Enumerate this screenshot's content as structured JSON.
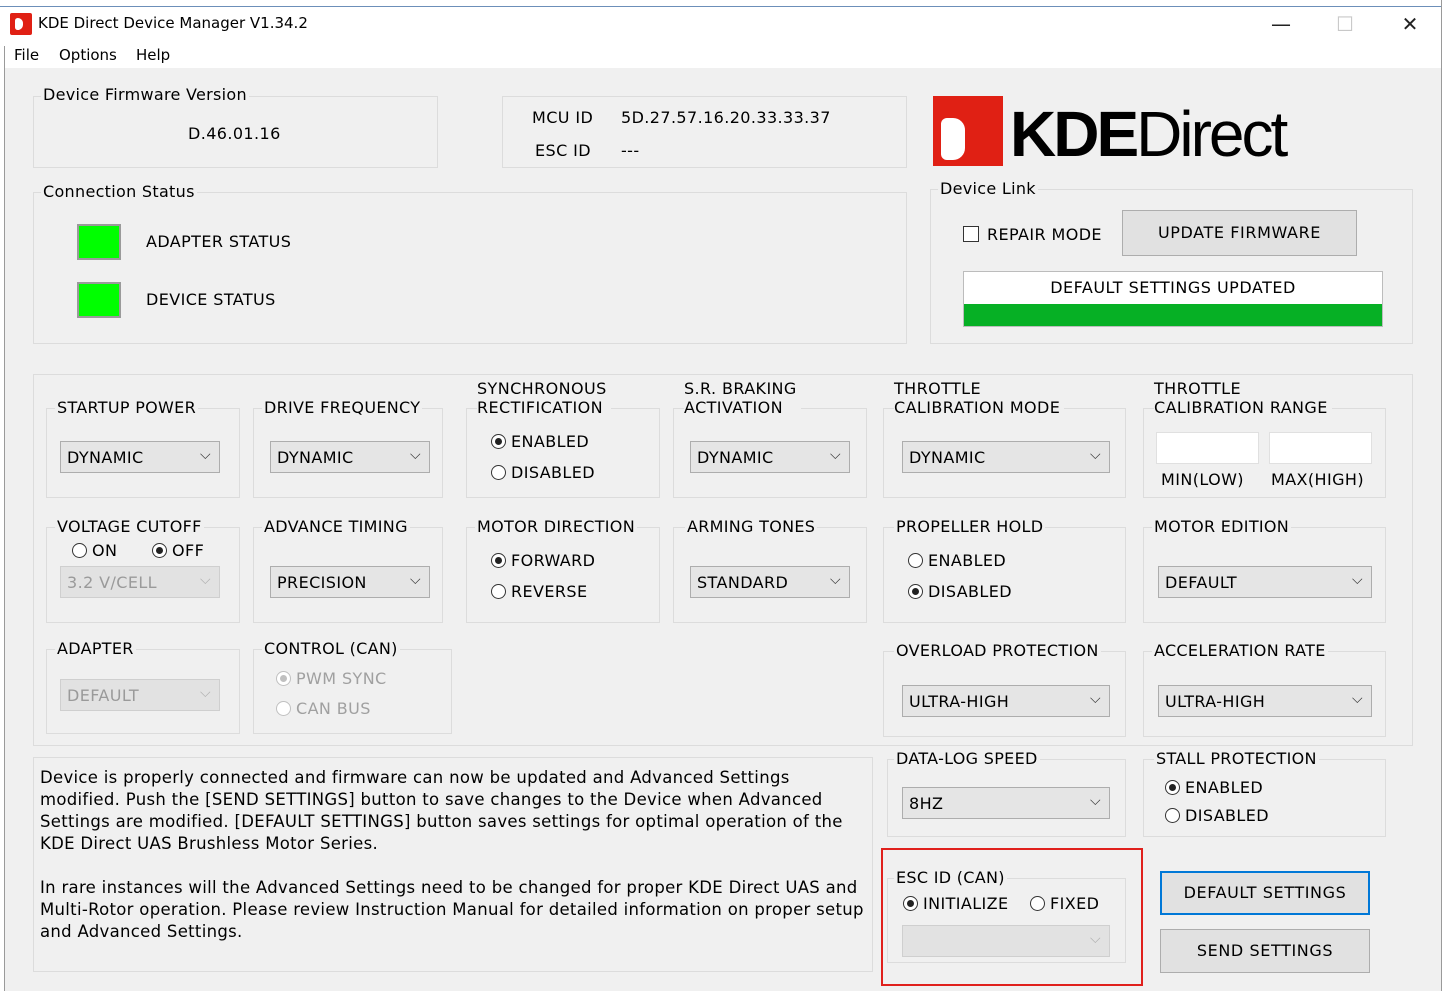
{
  "window": {
    "title": "KDE Direct Device Manager V1.34.2",
    "controls": {
      "minimize": "—",
      "maximize": "☐",
      "close": "✕"
    }
  },
  "menu": [
    "File",
    "Options",
    "Help"
  ],
  "logo": {
    "text_bold": "KDE",
    "text_light": "Direct",
    "color": "#e02014"
  },
  "firmware": {
    "label": "Device Firmware Version",
    "value": "D.46.01.16"
  },
  "ids": {
    "mcu_label": "MCU ID",
    "mcu_value": "5D.27.57.16.20.33.33.37",
    "esc_label": "ESC ID",
    "esc_value": "---"
  },
  "connection": {
    "label": "Connection Status",
    "adapter": "ADAPTER STATUS",
    "device": "DEVICE STATUS",
    "led_color": "#00ff00"
  },
  "device_link": {
    "label": "Device Link",
    "repair_mode": "REPAIR MODE",
    "repair_checked": false,
    "update_button": "UPDATE FIRMWARE",
    "status_text": "DEFAULT SETTINGS UPDATED",
    "progress": 1.0,
    "progress_color": "#06b025"
  },
  "settings": {
    "startup_power": {
      "label": "STARTUP POWER",
      "value": "DYNAMIC"
    },
    "drive_frequency": {
      "label": "DRIVE FREQUENCY",
      "value": "DYNAMIC"
    },
    "sync_rect": {
      "label1": "SYNCHRONOUS",
      "label2": "RECTIFICATION",
      "opt1": "ENABLED",
      "opt2": "DISABLED",
      "selected": "ENABLED"
    },
    "sr_braking": {
      "label1": "S.R. BRAKING",
      "label2": "ACTIVATION",
      "value": "DYNAMIC"
    },
    "throttle_cal_mode": {
      "label1": "THROTTLE",
      "label2": "CALIBRATION MODE",
      "value": "DYNAMIC"
    },
    "throttle_cal_range": {
      "label1": "THROTTLE",
      "label2": "CALIBRATION RANGE",
      "min_label": "MIN(LOW)",
      "max_label": "MAX(HIGH)",
      "min_value": "",
      "max_value": ""
    },
    "voltage_cutoff": {
      "label": "VOLTAGE CUTOFF",
      "on": "ON",
      "off": "OFF",
      "selected": "OFF",
      "value": "3.2 V/CELL"
    },
    "advance_timing": {
      "label": "ADVANCE TIMING",
      "value": "PRECISION"
    },
    "motor_direction": {
      "label": "MOTOR DIRECTION",
      "opt1": "FORWARD",
      "opt2": "REVERSE",
      "selected": "FORWARD"
    },
    "arming_tones": {
      "label": "ARMING TONES",
      "value": "STANDARD"
    },
    "propeller_hold": {
      "label": "PROPELLER HOLD",
      "opt1": "ENABLED",
      "opt2": "DISABLED",
      "selected": "DISABLED"
    },
    "motor_edition": {
      "label": "MOTOR EDITION",
      "value": "DEFAULT"
    },
    "adapter": {
      "label": "ADAPTER",
      "value": "DEFAULT"
    },
    "control_can": {
      "label": "CONTROL (CAN)",
      "opt1": "PWM SYNC",
      "opt2": "CAN BUS",
      "selected": "PWM SYNC"
    },
    "overload_protection": {
      "label": "OVERLOAD PROTECTION",
      "value": "ULTRA-HIGH"
    },
    "acceleration_rate": {
      "label": "ACCELERATION RATE",
      "value": "ULTRA-HIGH"
    },
    "datalog_speed": {
      "label": "DATA-LOG SPEED",
      "value": "8HZ"
    },
    "stall_protection": {
      "label": "STALL PROTECTION",
      "opt1": "ENABLED",
      "opt2": "DISABLED",
      "selected": "ENABLED"
    },
    "esc_id_can": {
      "label": "ESC ID (CAN)",
      "opt1": "INITIALIZE",
      "opt2": "FIXED",
      "selected": "INITIALIZE",
      "value": ""
    }
  },
  "info_text": "Device is properly connected and firmware can now be updated and Advanced Settings modified.  Push the [SEND SETTINGS] button to save changes to the Device when Advanced Settings are modified.  [DEFAULT SETTINGS] button saves settings for optimal operation of the KDE Direct UAS Brushless Motor Series.\n\nIn rare instances will the Advanced Settings need to be changed for proper KDE Direct UAS and Multi-Rotor operation.  Please review Instruction Manual for detailed information on proper setup and Advanced Settings.",
  "buttons": {
    "default_settings": "DEFAULT SETTINGS",
    "send_settings": "SEND SETTINGS"
  },
  "highlight_color": "#e0201c"
}
